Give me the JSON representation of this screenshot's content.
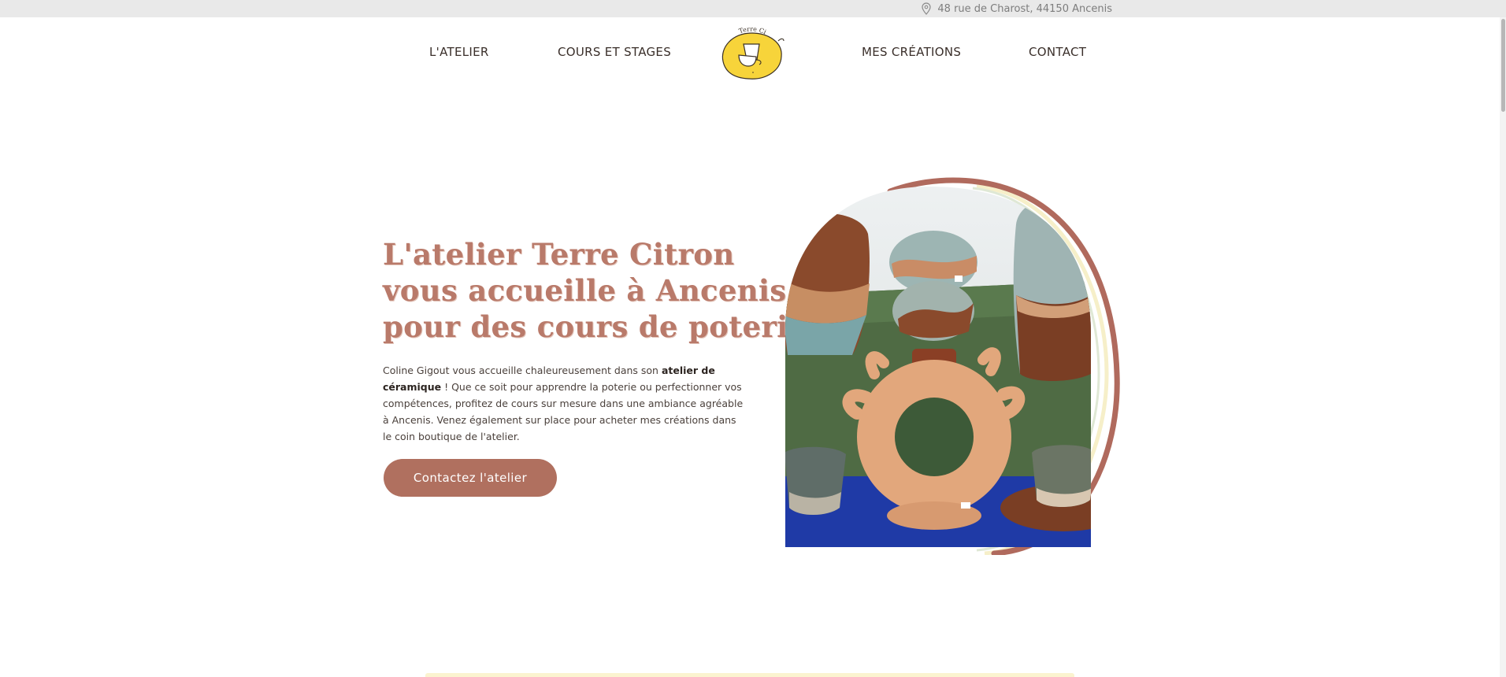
{
  "topbar": {
    "address": "48 rue de Charost, 44150 Ancenis",
    "address_icon": "map-pin-icon"
  },
  "nav": {
    "items": [
      {
        "label": "L'ATELIER"
      },
      {
        "label": "COURS ET STAGES"
      },
      {
        "label": "MES CRÉATIONS"
      },
      {
        "label": "CONTACT"
      }
    ],
    "logo_text": "Terre Citron"
  },
  "hero": {
    "title_lines": [
      "L'atelier Terre Citron",
      "vous accueille à Ancenis",
      "pour des cours de poterie"
    ],
    "desc_part1": "Coline Gigout vous accueille chaleureusement dans son ",
    "desc_bold": "atelier de céramique",
    "desc_part2": " ! Que ce soit pour apprendre la poterie ou perfectionner vos compétences, profitez de cours sur mesure dans une ambiance agréable à Ancenis. Venez également sur place pour acheter mes créations dans le coin boutique de l'atelier.",
    "cta_label": "Contactez l'atelier"
  },
  "colors": {
    "accent": "#b0705f",
    "title": "#b97a6a",
    "logo_yellow": "#f7d43a",
    "arch_stroke": "#b06a5d"
  }
}
